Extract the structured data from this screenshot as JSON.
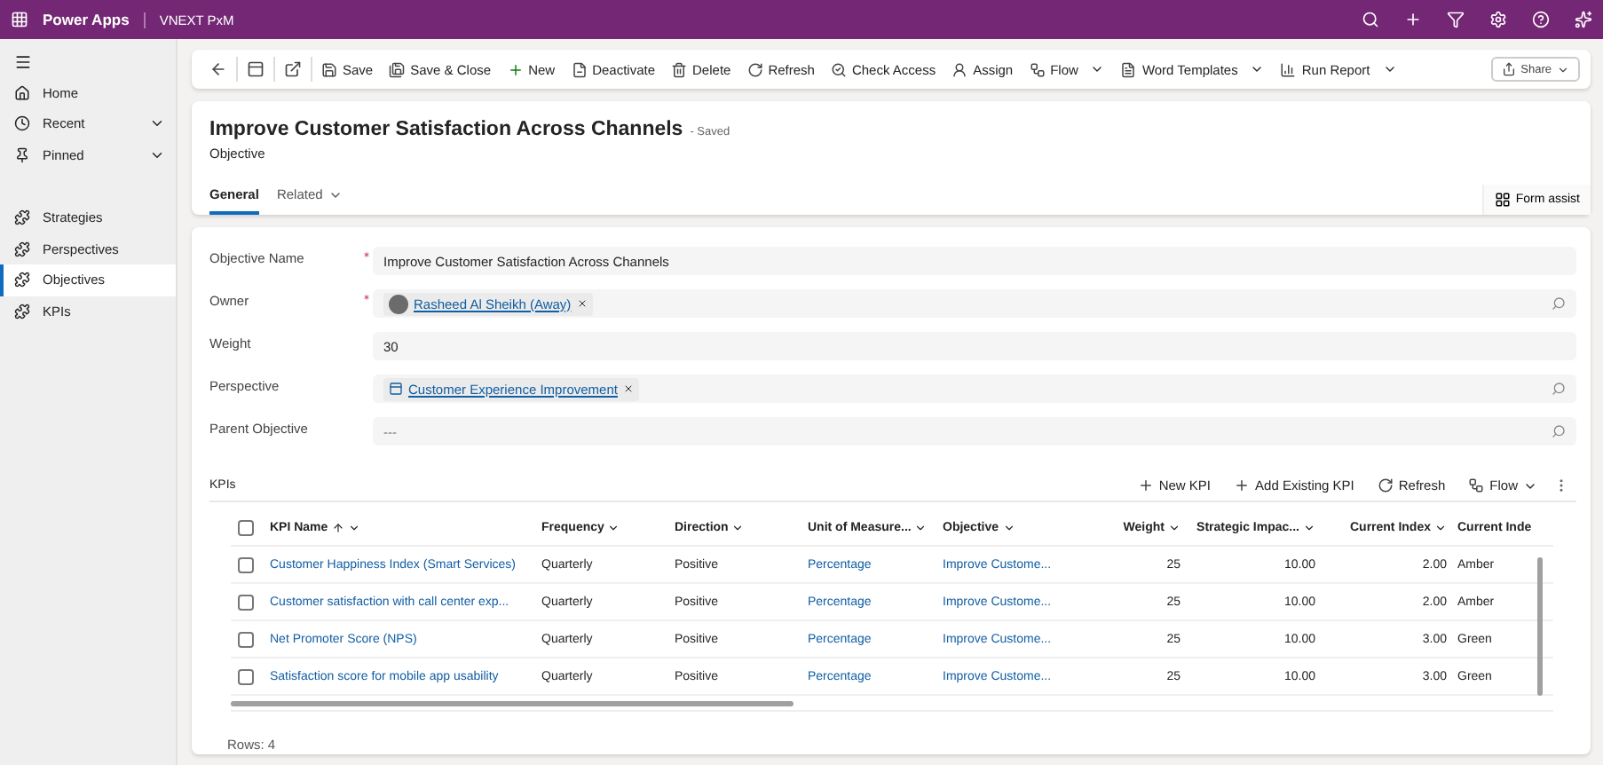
{
  "app_bar": {
    "app_name": "Power Apps",
    "environment": "VNEXT PxM"
  },
  "sidebar": {
    "nav": [
      {
        "label": "Home",
        "kind": "link"
      },
      {
        "label": "Recent",
        "kind": "group"
      },
      {
        "label": "Pinned",
        "kind": "group"
      }
    ],
    "areas": [
      {
        "label": "Strategies",
        "selected": false
      },
      {
        "label": "Perspectives",
        "selected": false
      },
      {
        "label": "Objectives",
        "selected": true
      },
      {
        "label": "KPIs",
        "selected": false
      }
    ]
  },
  "command_bar": {
    "commands": [
      {
        "label": "Save",
        "kind": "button"
      },
      {
        "label": "Save & Close",
        "kind": "button"
      },
      {
        "label": "New",
        "kind": "button"
      },
      {
        "label": "Deactivate",
        "kind": "button"
      },
      {
        "label": "Delete",
        "kind": "button"
      },
      {
        "label": "Refresh",
        "kind": "button"
      },
      {
        "label": "Check Access",
        "kind": "button"
      },
      {
        "label": "Assign",
        "kind": "button"
      },
      {
        "label": "Flow",
        "kind": "menu"
      },
      {
        "label": "Word Templates",
        "kind": "menu"
      },
      {
        "label": "Run Report",
        "kind": "menu"
      }
    ],
    "share": "Share"
  },
  "record": {
    "title": "Improve Customer Satisfaction Across Channels",
    "status": "- Saved",
    "entity": "Objective",
    "tabs": [
      {
        "label": "General",
        "selected": true,
        "kind": "tab"
      },
      {
        "label": "Related",
        "selected": false,
        "kind": "menu"
      }
    ],
    "form_assist": "Form assist"
  },
  "fields": [
    {
      "label": "Objective Name",
      "required": true,
      "kind": "text",
      "value": "Improve Customer Satisfaction Across Channels"
    },
    {
      "label": "Owner",
      "required": true,
      "kind": "person",
      "value": "Rasheed Al Sheikh (Away)"
    },
    {
      "label": "Weight",
      "required": false,
      "kind": "text",
      "value": "30"
    },
    {
      "label": "Perspective",
      "required": false,
      "kind": "record",
      "value": "Customer Experience Improvement"
    },
    {
      "label": "Parent Objective",
      "required": false,
      "kind": "lookup",
      "placeholder": "---"
    }
  ],
  "kpis": {
    "title": "KPIs",
    "commands": [
      {
        "label": "New KPI",
        "kind": "button"
      },
      {
        "label": "Add Existing KPI",
        "kind": "button"
      },
      {
        "label": "Refresh",
        "kind": "button"
      },
      {
        "label": "Flow",
        "kind": "menu"
      }
    ],
    "all_checked": false,
    "columns": [
      {
        "label": "KPI Name",
        "kind": "link",
        "sorted": true,
        "menu": true
      },
      {
        "label": "Frequency",
        "kind": "text",
        "sorted": false,
        "menu": true
      },
      {
        "label": "Direction",
        "kind": "text",
        "sorted": false,
        "menu": true
      },
      {
        "label": "Unit of Measure...",
        "kind": "link",
        "sorted": false,
        "menu": true
      },
      {
        "label": "Objective",
        "kind": "link",
        "sorted": false,
        "menu": true
      },
      {
        "label": "Weight",
        "kind": "number",
        "sorted": false,
        "menu": true
      },
      {
        "label": "Strategic Impac...",
        "kind": "number",
        "sorted": false,
        "menu": true
      },
      {
        "label": "Current Index",
        "kind": "number",
        "sorted": false,
        "menu": true
      },
      {
        "label": "Current Inde",
        "kind": "text",
        "sorted": false,
        "menu": false
      }
    ],
    "rows": [
      {
        "checked": false,
        "cells": [
          "Customer Happiness Index (Smart Services)",
          "Quarterly",
          "Positive",
          "Percentage",
          "Improve Custome...",
          "25",
          "10.00",
          "2.00",
          "Amber"
        ]
      },
      {
        "checked": false,
        "cells": [
          "Customer satisfaction with call center exp...",
          "Quarterly",
          "Positive",
          "Percentage",
          "Improve Custome...",
          "25",
          "10.00",
          "2.00",
          "Amber"
        ]
      },
      {
        "checked": false,
        "cells": [
          "Net Promoter Score (NPS)",
          "Quarterly",
          "Positive",
          "Percentage",
          "Improve Custome...",
          "25",
          "10.00",
          "3.00",
          "Green"
        ]
      },
      {
        "checked": false,
        "cells": [
          "Satisfaction score for mobile app usability",
          "Quarterly",
          "Positive",
          "Percentage",
          "Improve Custome...",
          "25",
          "10.00",
          "3.00",
          "Green"
        ]
      }
    ],
    "footer": "Rows: 4"
  }
}
